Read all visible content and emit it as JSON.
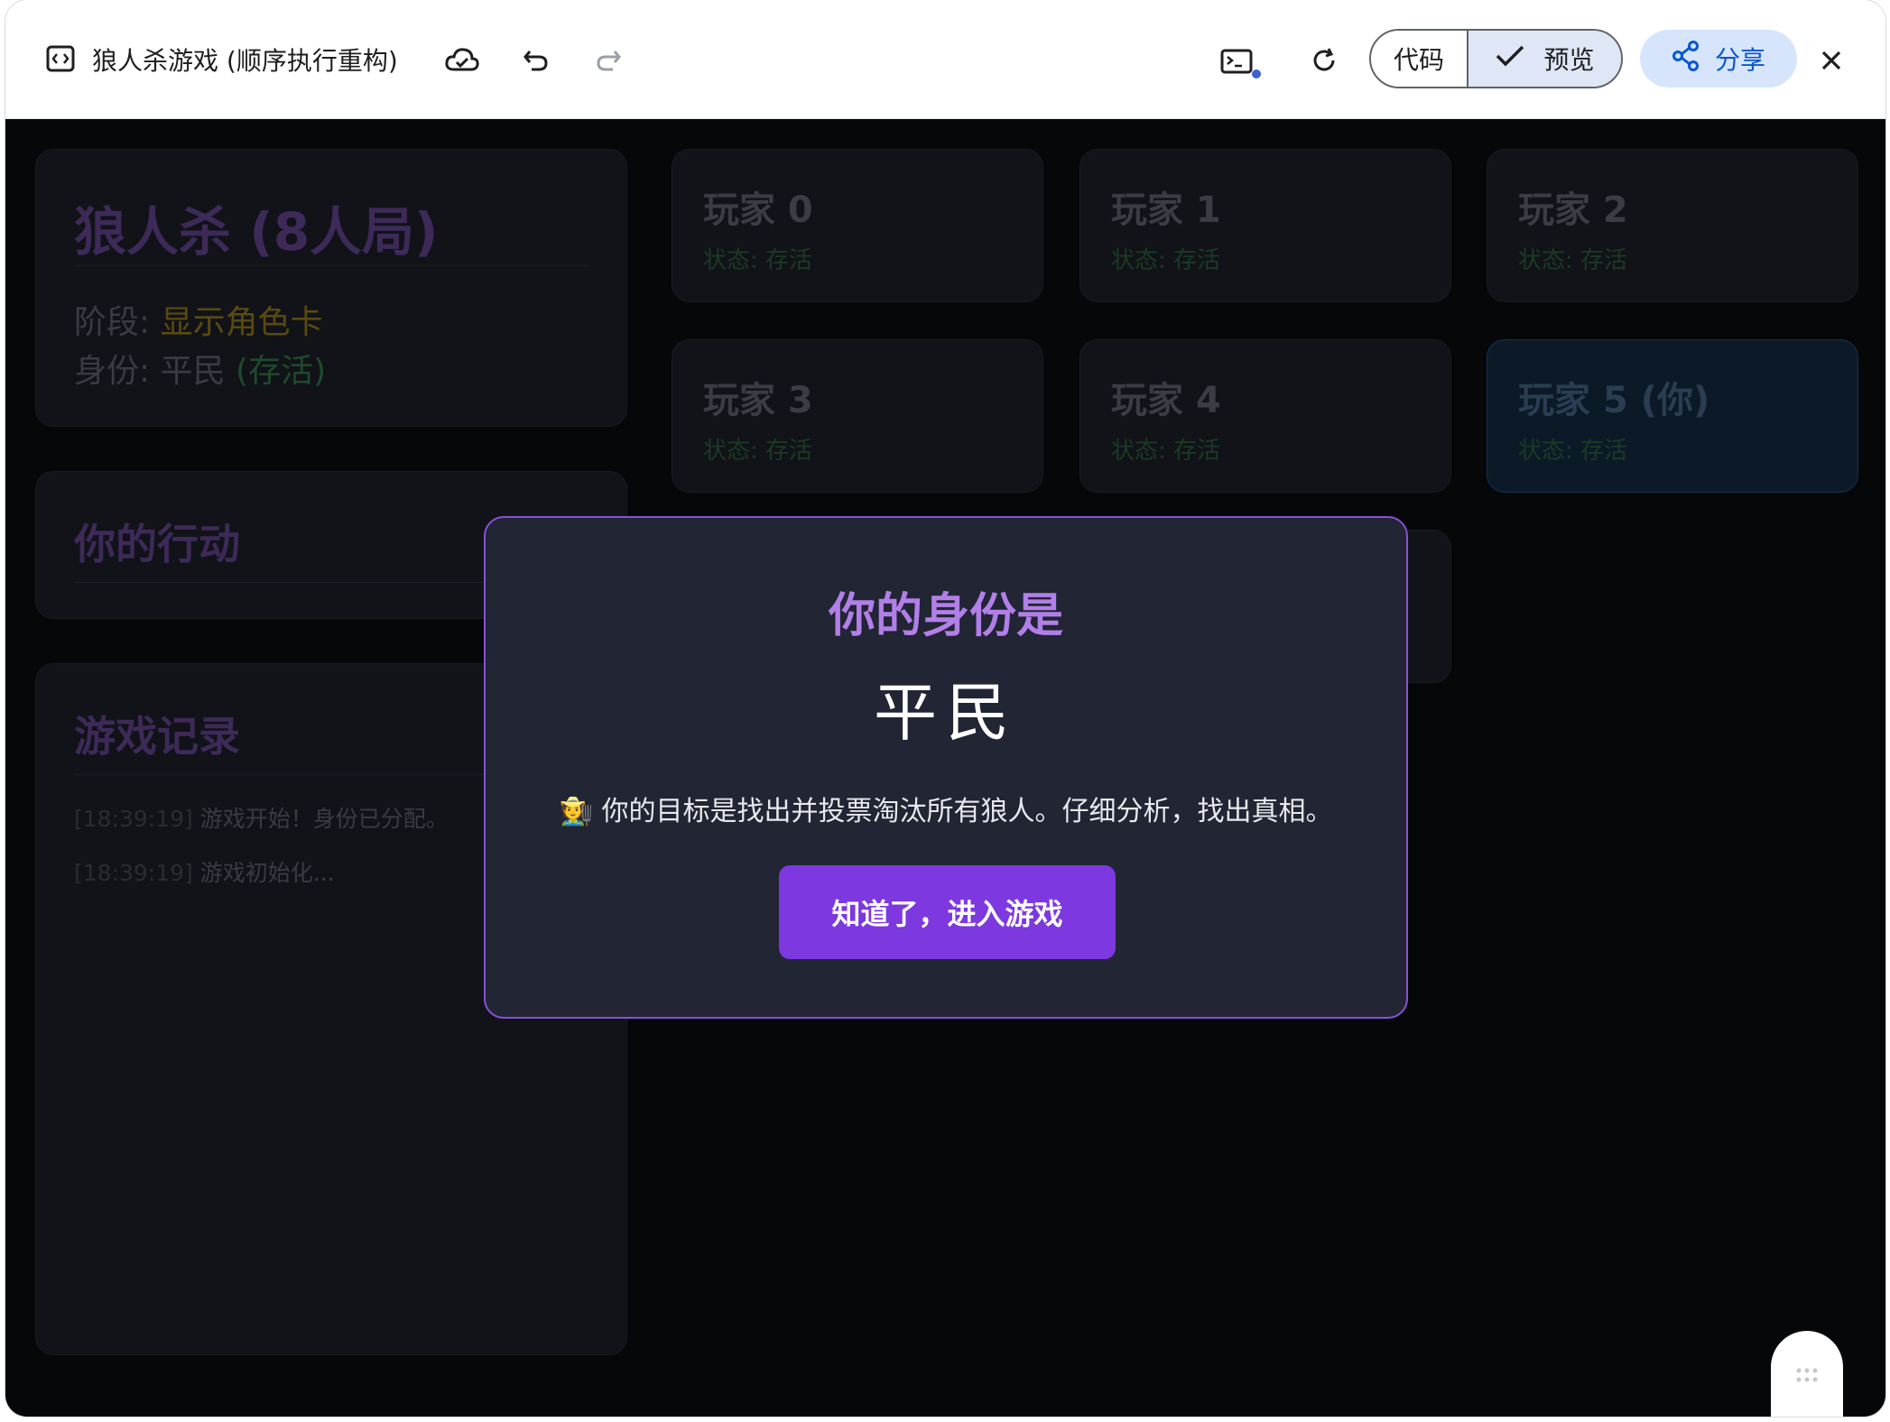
{
  "toolbar": {
    "title": "狼人杀游戏 (顺序执行重构)",
    "code_label": "代码",
    "preview_label": "预览",
    "share_label": "分享"
  },
  "game_info": {
    "title": "狼人杀 (8人局)",
    "phase_label": "阶段: ",
    "phase_value": "显示角色卡",
    "identity_label": "身份: 平民 ",
    "identity_status": "(存活)"
  },
  "actions": {
    "title": "你的行动"
  },
  "log": {
    "title": "游戏记录",
    "entries": [
      {
        "time": "[18:39:19]",
        "text": "游戏开始！身份已分配。"
      },
      {
        "time": "[18:39:19]",
        "text": "游戏初始化..."
      }
    ]
  },
  "players": [
    {
      "name": "玩家 0",
      "status": "状态: 存活"
    },
    {
      "name": "玩家 1",
      "status": "状态: 存活"
    },
    {
      "name": "玩家 2",
      "status": "状态: 存活"
    },
    {
      "name": "玩家 3",
      "status": "状态: 存活"
    },
    {
      "name": "玩家 4",
      "status": "状态: 存活"
    },
    {
      "name": "玩家 5 (你)",
      "status": "状态: 存活"
    }
  ],
  "modal": {
    "heading": "你的身份是",
    "role": "平民",
    "emoji": "🧑‍🌾",
    "description": "你的目标是找出并投票淘汰所有狼人。仔细分析，找出真相。",
    "button_label": "知道了，进入游戏"
  },
  "colors": {
    "accent_purple": "#7d38df",
    "phase_gold": "#5a4a10",
    "share_blue": "#0b57d0"
  }
}
